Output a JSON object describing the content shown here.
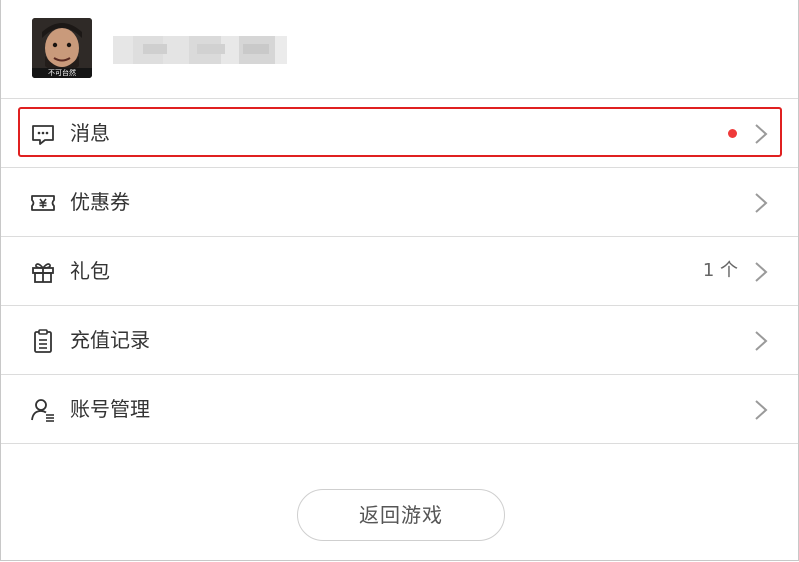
{
  "profile": {
    "avatar_caption": "不可台然"
  },
  "menu": {
    "items": [
      {
        "label": "消息",
        "icon": "message-icon",
        "badge": "red-dot"
      },
      {
        "label": "优惠券",
        "icon": "coupon-icon"
      },
      {
        "label": "礼包",
        "icon": "gift-icon",
        "value": "1 个"
      },
      {
        "label": "充值记录",
        "icon": "clipboard-icon"
      },
      {
        "label": "账号管理",
        "icon": "account-icon"
      }
    ]
  },
  "footer": {
    "return_button_label": "返回游戏"
  },
  "colors": {
    "highlight_border": "#e02020",
    "badge_dot": "#ef3a3a",
    "divider": "#dcdcdc",
    "text": "#333333"
  }
}
